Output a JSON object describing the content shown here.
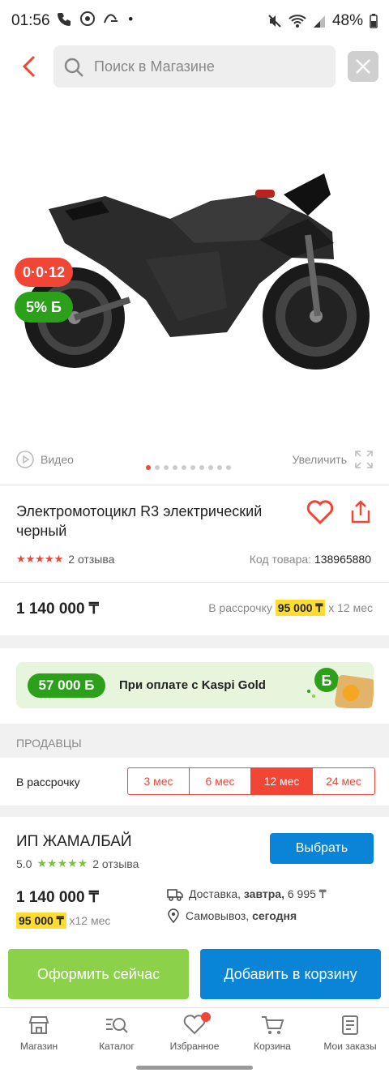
{
  "status_bar": {
    "time": "01:56",
    "battery": "48%",
    "left_icons": [
      "phone-wifi-icon",
      "chrome-icon",
      "app-icon",
      "dot"
    ],
    "right_icons": [
      "mute-icon",
      "wifi-icon",
      "signal-icon",
      "battery-icon"
    ]
  },
  "header": {
    "search_placeholder": "Поиск в Магазине"
  },
  "gallery": {
    "badge_installment": "0·0·12",
    "badge_bonus": "5%",
    "bonus_symbol": "Б",
    "video_label": "Видео",
    "zoom_label": "Увеличить",
    "dots_count": 10,
    "active_dot": 0
  },
  "product": {
    "title": "Электромотоцикл R3 электрический черный",
    "rating_stars": 5,
    "reviews": "2 отзыва",
    "code_label": "Код товара:",
    "code_value": "138965880",
    "price": "1 140 000 ₸",
    "installment_prefix": "В рассрочку",
    "installment_amount": "95 000 ₸",
    "installment_suffix": "x 12 мес"
  },
  "kaspi_gold": {
    "amount": "57 000",
    "symbol": "Б",
    "text": "При оплате с Kaspi Gold"
  },
  "sellers": {
    "heading": "ПРОДАВЦЫ",
    "installment_label": "В рассрочку",
    "tabs": [
      "3 мес",
      "6 мес",
      "12 мес",
      "24 мес"
    ],
    "active_tab": "12 мес",
    "seller": {
      "name": "ИП ЖАМАЛБАЙ",
      "rating": "5.0",
      "reviews": "2 отзыва",
      "choose_label": "Выбрать",
      "price": "1 140 000 ₸",
      "installment_amount": "95 000 ₸",
      "installment_suffix": "x12 мес",
      "delivery_prefix": "Доставка,",
      "delivery_day": "завтра,",
      "delivery_price": "6 995 ₸",
      "pickup_prefix": "Самовывоз,",
      "pickup_day": "сегодня"
    }
  },
  "actions": {
    "buy_now": "Оформить сейчас",
    "add_to_cart": "Добавить в корзину"
  },
  "bottom_nav": [
    {
      "label": "Магазин",
      "icon": "store-icon"
    },
    {
      "label": "Каталог",
      "icon": "catalog-search-icon"
    },
    {
      "label": "Избранное",
      "icon": "heart-icon"
    },
    {
      "label": "Корзина",
      "icon": "cart-icon"
    },
    {
      "label": "Мои заказы",
      "icon": "orders-icon"
    }
  ],
  "colors": {
    "accent_red": "#f14635",
    "kaspi_green": "#2c9f1b",
    "blue": "#0a84d6",
    "light_green": "#8bd14a",
    "highlight_yellow": "#ffdc32"
  }
}
